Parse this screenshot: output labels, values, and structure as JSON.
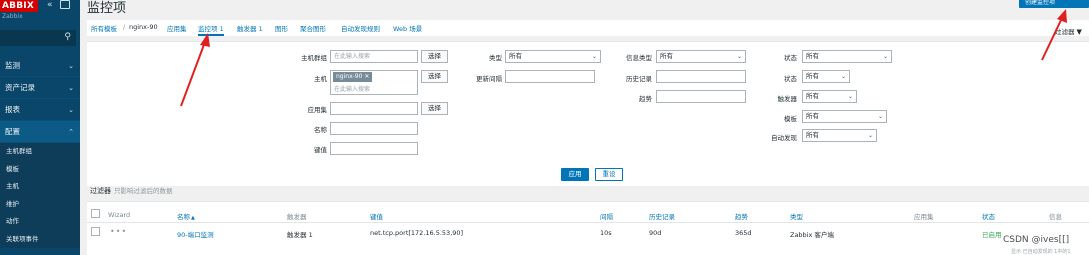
{
  "sidebar": {
    "logo": "ABBIX",
    "logo_sub": "Zabbix",
    "collapse_icon": "double-chevron-left-icon",
    "menu": [
      {
        "label": "监测"
      },
      {
        "label": "资产记录"
      },
      {
        "label": "报表"
      },
      {
        "label": "配置"
      }
    ],
    "submenu": [
      "主机群组",
      "模板",
      "主机",
      "维护",
      "动作",
      "关联项事件"
    ]
  },
  "header": {
    "title": "监控项",
    "create_button": "创建监控项"
  },
  "breadcrumb": {
    "all_templates": "所有模板",
    "separator": "/",
    "host": "nginx-90",
    "tabs": [
      "应用集",
      "监控项 1",
      "触发器 1",
      "图形",
      "聚合图形",
      "自动发现规则",
      "Web 场景"
    ]
  },
  "filter_toggle": "过滤器",
  "filter": {
    "host_group_label": "主机群组",
    "host_group_placeholder": "在此输入搜索",
    "select_button": "选择",
    "host_label": "主机",
    "host_tag": "nginx-90",
    "host_placeholder": "在此输入搜索",
    "application_label": "应用集",
    "name_label": "名称",
    "key_label": "键值",
    "type_label": "类型",
    "type_value": "所有",
    "update_interval_label": "更新间隔",
    "info_type_label": "信息类型",
    "info_type_value": "所有",
    "history_label": "历史记录",
    "trends_label": "趋势",
    "state_label": "状态",
    "state_value": "所有",
    "status_label": "状态",
    "status_value": "所有",
    "triggers_label": "触发器",
    "triggers_value": "所有",
    "template_label": "模板",
    "template_value": "所有",
    "discovered_label": "自动发现",
    "discovered_value": "所有",
    "apply_button": "应用",
    "reset_button": "重设"
  },
  "subfilter": {
    "label": "过滤器",
    "hint": "只影响过滤后的数据"
  },
  "table": {
    "headers": [
      "Wizard",
      "名称",
      "触发器",
      "键值",
      "间隔",
      "历史记录",
      "趋势",
      "类型",
      "应用集",
      "状态",
      "信息"
    ],
    "rows": [
      {
        "name": "90-端口监测",
        "triggers": "触发器 1",
        "key": "net.tcp.port[172.16.5.53,90]",
        "interval": "10s",
        "history": "90d",
        "trends": "365d",
        "type": "Zabbix 客户端",
        "application": "",
        "status": "已启用",
        "info": ""
      }
    ]
  },
  "watermark": "CSDN @ives[[]",
  "footer_note": "显示 已自动发现的 1中的1"
}
